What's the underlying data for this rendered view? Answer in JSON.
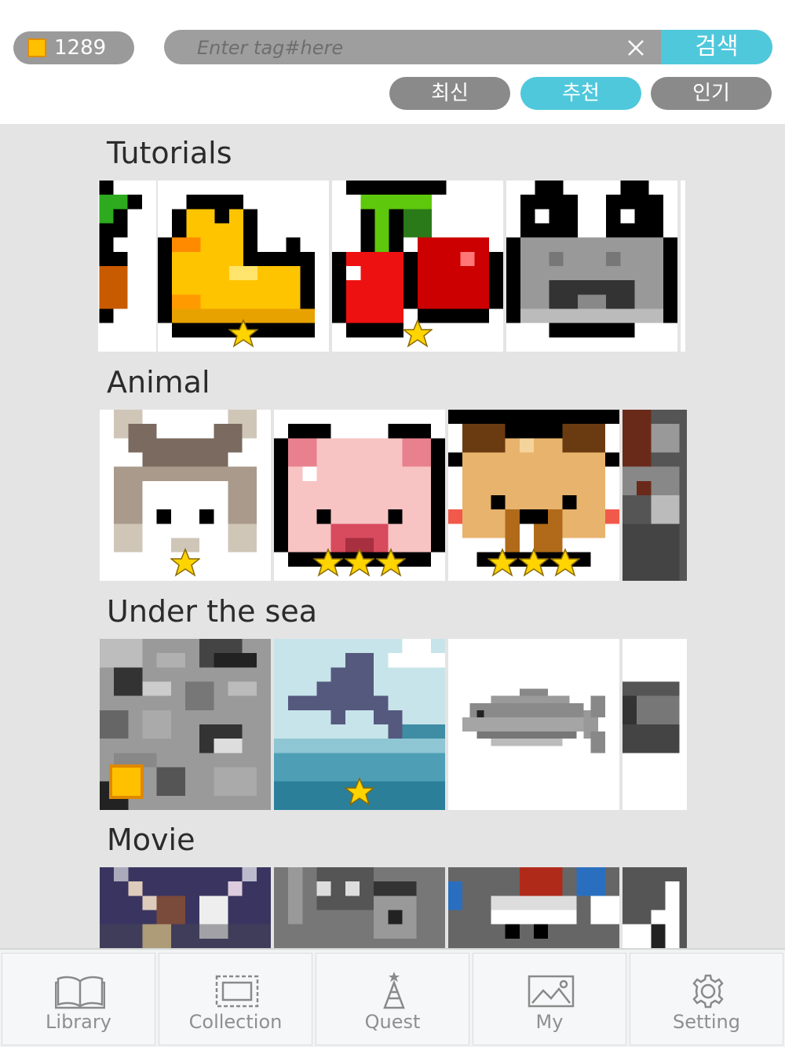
{
  "header": {
    "coins": "1289",
    "search": {
      "placeholder": "Enter tag#here",
      "button_label": "검색"
    },
    "sort_tabs": [
      {
        "label": "최신",
        "active": false
      },
      {
        "label": "추천",
        "active": true
      },
      {
        "label": "인기",
        "active": false
      }
    ]
  },
  "sections": [
    {
      "title": "Tutorials",
      "items": [
        {
          "name": "tutorial-partial",
          "stars": 0
        },
        {
          "name": "duck",
          "stars": 1
        },
        {
          "name": "cherry",
          "stars": 1
        },
        {
          "name": "frog",
          "stars": 0
        },
        {
          "name": "tutorial-edge",
          "stars": 0
        }
      ]
    },
    {
      "title": "Animal",
      "items": [
        {
          "name": "husky",
          "stars": 1
        },
        {
          "name": "pig",
          "stars": 3
        },
        {
          "name": "bear",
          "stars": 3
        },
        {
          "name": "animal-partial",
          "stars": 0
        }
      ]
    },
    {
      "title": "Under the sea",
      "items": [
        {
          "name": "clownfish",
          "stars": 0,
          "coin_badge": true
        },
        {
          "name": "dolphin",
          "stars": 1
        },
        {
          "name": "fish",
          "stars": 0
        },
        {
          "name": "sea-partial",
          "stars": 0
        }
      ]
    },
    {
      "title": "Movie",
      "items": [
        {
          "name": "dance",
          "stars": 0
        },
        {
          "name": "portrait",
          "stars": 0
        },
        {
          "name": "santa",
          "stars": 0
        },
        {
          "name": "movie-partial",
          "stars": 0
        }
      ]
    }
  ],
  "bottom_nav": [
    {
      "label": "Library",
      "icon": "book-icon"
    },
    {
      "label": "Collection",
      "icon": "stamp-icon"
    },
    {
      "label": "Quest",
      "icon": "tower-icon"
    },
    {
      "label": "My",
      "icon": "picture-icon"
    },
    {
      "label": "Setting",
      "icon": "gear-icon"
    }
  ],
  "colors": {
    "accent": "#4fc8dc",
    "pill_gray": "#9e9e9e",
    "star": "#ffd400",
    "coin": "#ffc000"
  }
}
